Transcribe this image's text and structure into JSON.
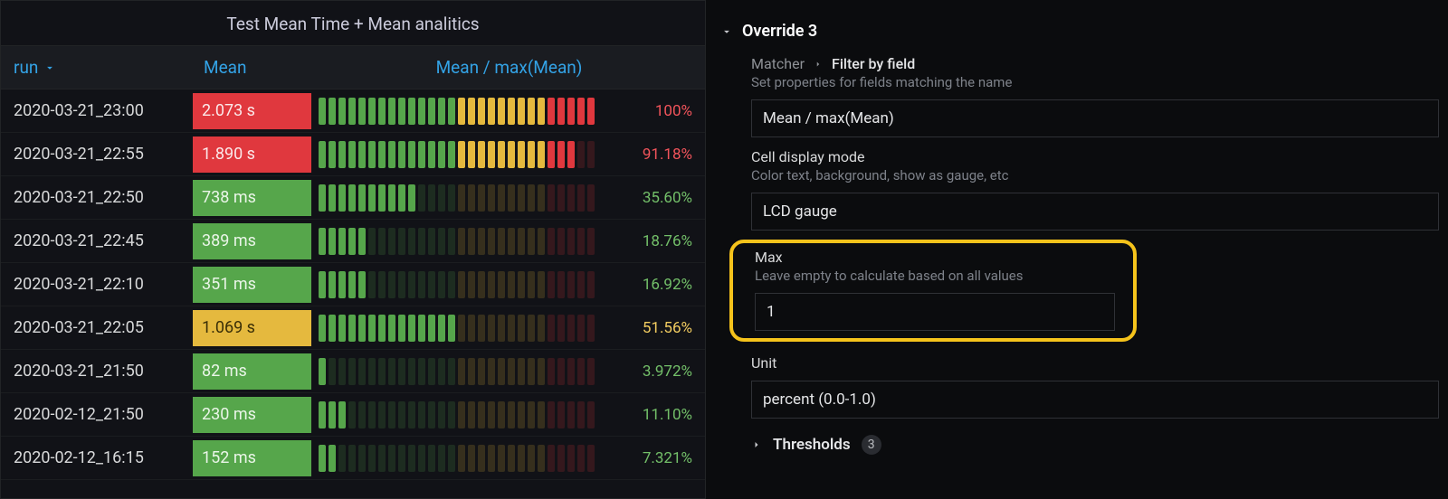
{
  "panel": {
    "title": "Test Mean Time + Mean analitics",
    "columns": {
      "run": "run",
      "mean": "Mean",
      "gauge": "Mean / max(Mean)"
    },
    "rows": [
      {
        "run": "2020-03-21_23:00",
        "mean": "2.073 s",
        "mean_color": "red",
        "pct": "100%",
        "pct_color": "red",
        "value": 1.0
      },
      {
        "run": "2020-03-21_22:55",
        "mean": "1.890 s",
        "mean_color": "red",
        "pct": "91.18%",
        "pct_color": "red",
        "value": 0.9118
      },
      {
        "run": "2020-03-21_22:50",
        "mean": "738 ms",
        "mean_color": "green",
        "pct": "35.60%",
        "pct_color": "green",
        "value": 0.356
      },
      {
        "run": "2020-03-21_22:45",
        "mean": "389 ms",
        "mean_color": "green",
        "pct": "18.76%",
        "pct_color": "green",
        "value": 0.1876
      },
      {
        "run": "2020-03-21_22:10",
        "mean": "351 ms",
        "mean_color": "green",
        "pct": "16.92%",
        "pct_color": "green",
        "value": 0.1692
      },
      {
        "run": "2020-03-21_22:05",
        "mean": "1.069 s",
        "mean_color": "yellow",
        "pct": "51.56%",
        "pct_color": "yellow",
        "value": 0.5156
      },
      {
        "run": "2020-03-21_21:50",
        "mean": "82 ms",
        "mean_color": "green",
        "pct": "3.972%",
        "pct_color": "green",
        "value": 0.03972
      },
      {
        "run": "2020-02-12_21:50",
        "mean": "230 ms",
        "mean_color": "green",
        "pct": "11.10%",
        "pct_color": "green",
        "value": 0.111
      },
      {
        "run": "2020-02-12_16:15",
        "mean": "152 ms",
        "mean_color": "green",
        "pct": "7.321%",
        "pct_color": "green",
        "value": 0.07321
      }
    ],
    "gauge": {
      "segments": 28,
      "green_end": 14,
      "yellow_end": 23
    }
  },
  "sidebar": {
    "override_title": "Override 3",
    "matcher": {
      "label": "Matcher",
      "value_label": "Filter by field",
      "hint": "Set properties for fields matching the name",
      "value": "Mean / max(Mean)"
    },
    "display": {
      "label": "Cell display mode",
      "hint": "Color text, background, show as gauge, etc",
      "value": "LCD gauge"
    },
    "max": {
      "label": "Max",
      "hint": "Leave empty to calculate based on all values",
      "value": "1"
    },
    "unit": {
      "label": "Unit",
      "value": "percent (0.0-1.0)"
    },
    "thresholds": {
      "label": "Thresholds",
      "count": "3"
    }
  },
  "chart_data": {
    "type": "table",
    "title": "Test Mean Time + Mean analitics",
    "columns": [
      "run",
      "Mean",
      "Mean / max(Mean)"
    ],
    "rows": [
      [
        "2020-03-21_23:00",
        "2.073 s",
        "100%"
      ],
      [
        "2020-03-21_22:55",
        "1.890 s",
        "91.18%"
      ],
      [
        "2020-03-21_22:50",
        "738 ms",
        "35.60%"
      ],
      [
        "2020-03-21_22:45",
        "389 ms",
        "18.76%"
      ],
      [
        "2020-03-21_22:10",
        "351 ms",
        "16.92%"
      ],
      [
        "2020-03-21_22:05",
        "1.069 s",
        "51.56%"
      ],
      [
        "2020-03-21_21:50",
        "82 ms",
        "3.972%"
      ],
      [
        "2020-02-12_21:50",
        "230 ms",
        "11.10%"
      ],
      [
        "2020-02-12_16:15",
        "152 ms",
        "7.321%"
      ]
    ]
  }
}
